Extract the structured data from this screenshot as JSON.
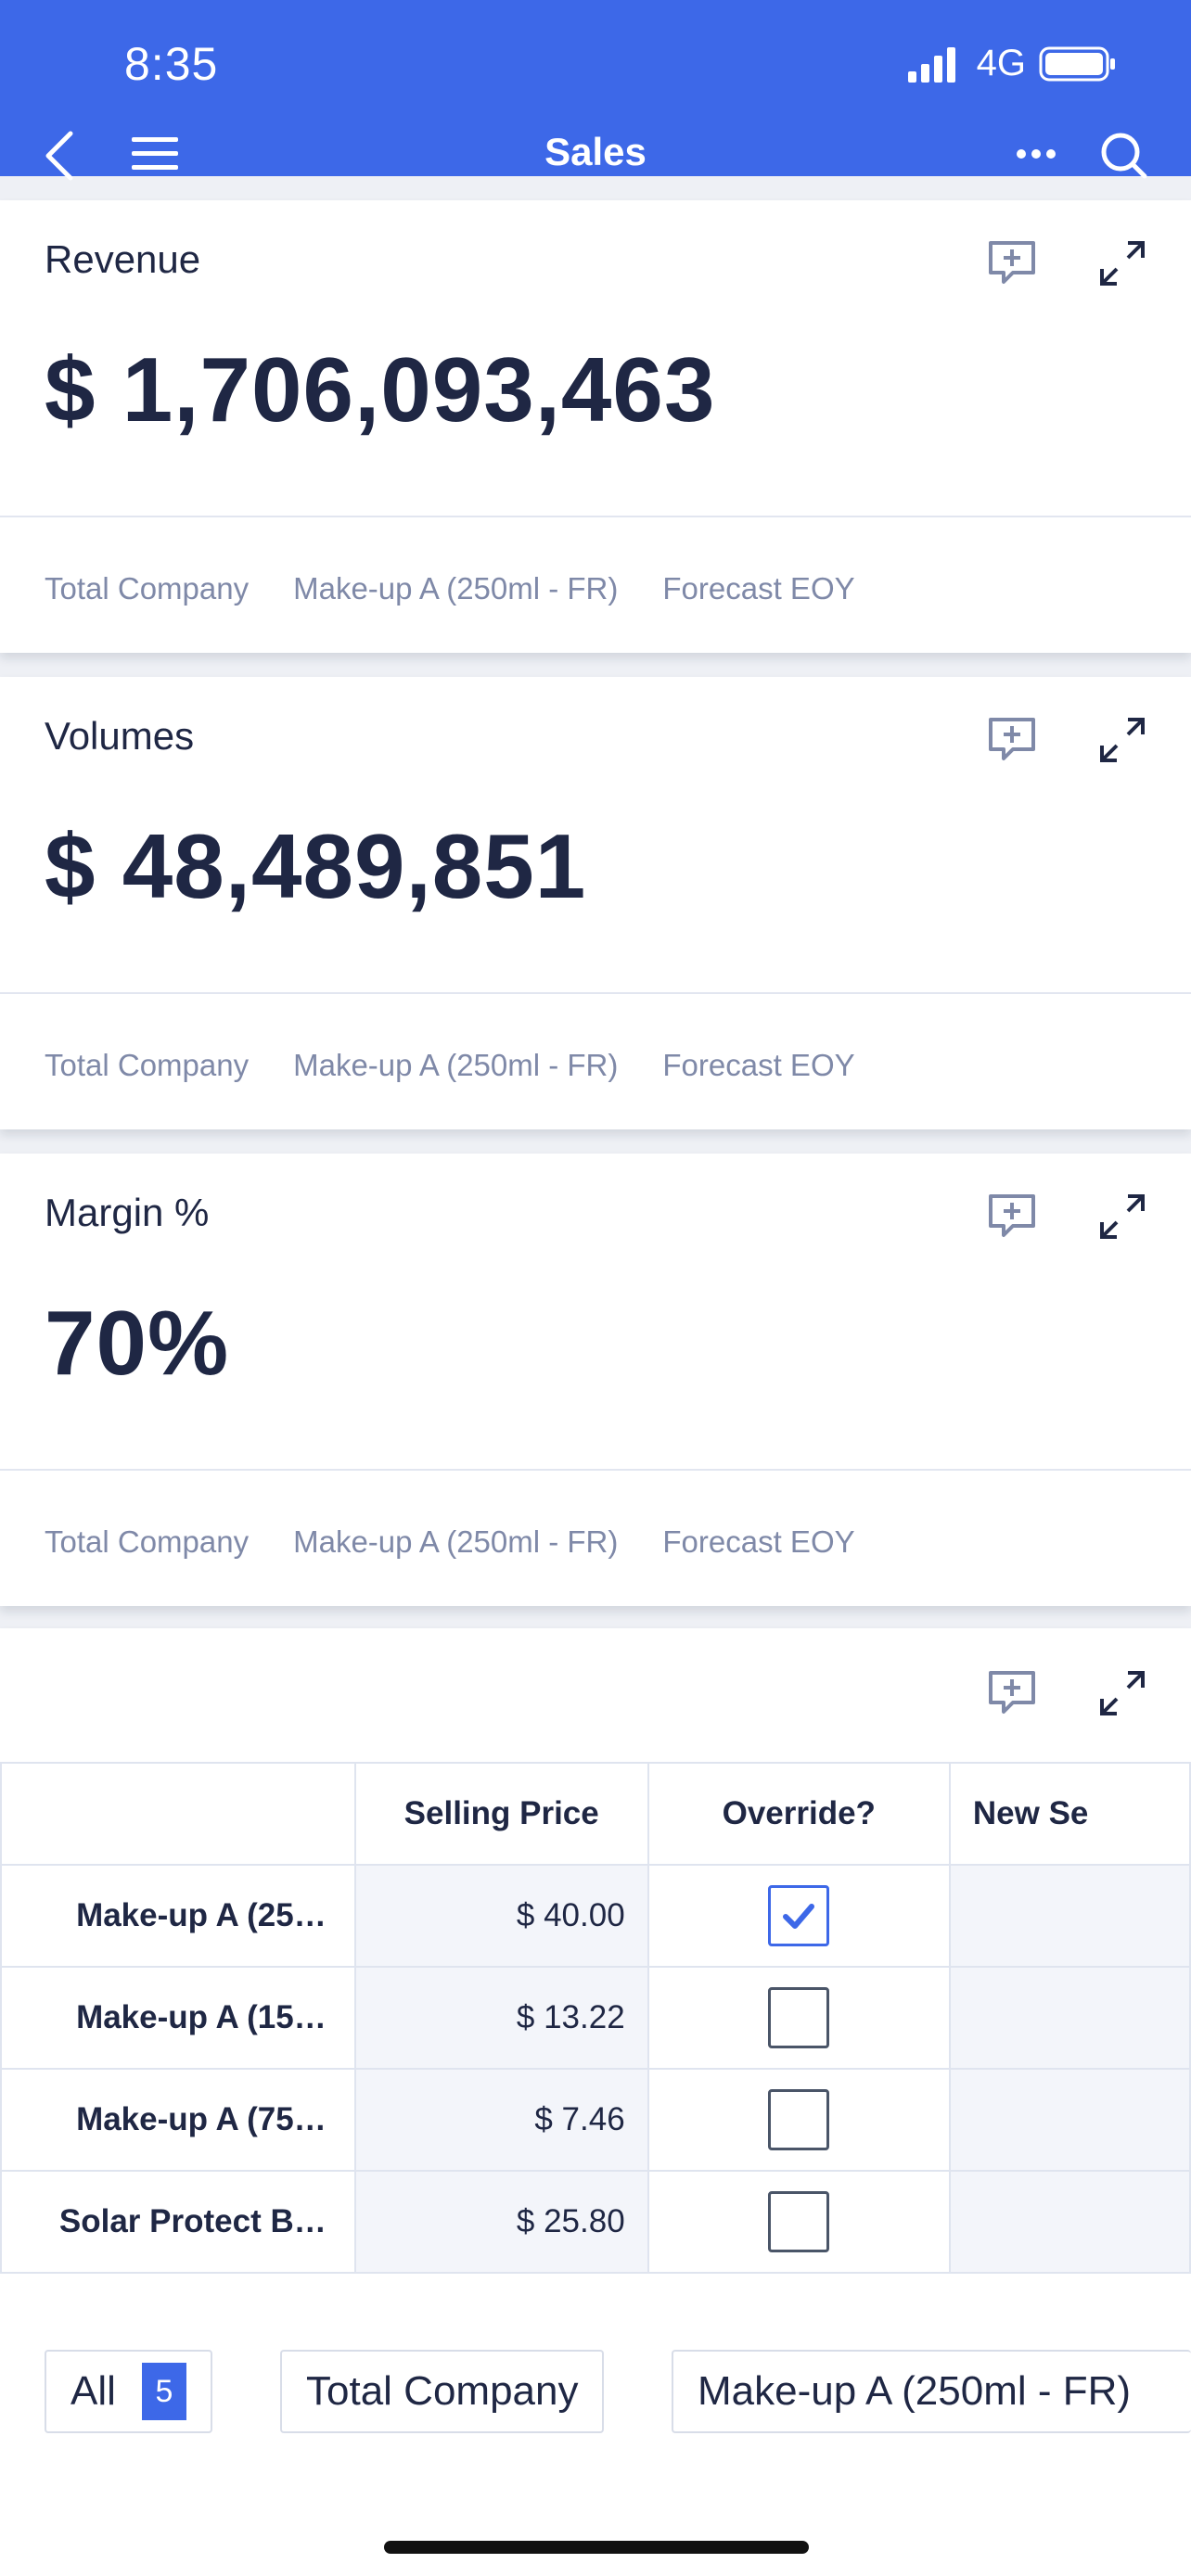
{
  "status_bar": {
    "time": "8:35",
    "network": "4G"
  },
  "nav": {
    "title": "Sales"
  },
  "cards": [
    {
      "title": "Revenue",
      "value": "$ 1,706,093,463",
      "tags": [
        "Total Company",
        "Make-up A (250ml - FR)",
        "Forecast EOY"
      ]
    },
    {
      "title": "Volumes",
      "value": "$ 48,489,851",
      "tags": [
        "Total Company",
        "Make-up A (250ml - FR)",
        "Forecast EOY"
      ]
    },
    {
      "title": "Margin %",
      "value": "70%",
      "tags": [
        "Total Company",
        "Make-up A (250ml - FR)",
        "Forecast EOY"
      ]
    }
  ],
  "table": {
    "headers": [
      "",
      "Selling Price",
      "Override?",
      "New Se"
    ],
    "rows": [
      {
        "label": "Make-up A (25…",
        "price": "$ 40.00",
        "override": true
      },
      {
        "label": "Make-up A (15…",
        "price": "$ 13.22",
        "override": false
      },
      {
        "label": "Make-up A (75…",
        "price": "$ 7.46",
        "override": false
      },
      {
        "label": "Solar Protect B…",
        "price": "$ 25.80",
        "override": false
      }
    ]
  },
  "filters": {
    "all_label": "All",
    "all_count": "5",
    "company": "Total Company",
    "product": "Make-up A (250ml - FR)"
  },
  "colors": {
    "accent": "#3d68e8",
    "text": "#1f2744",
    "muted": "#7f89a8"
  },
  "icons": [
    "back-icon",
    "menu-icon",
    "more-icon",
    "search-icon",
    "add-comment-icon",
    "expand-icon",
    "signal-icon",
    "battery-icon"
  ]
}
